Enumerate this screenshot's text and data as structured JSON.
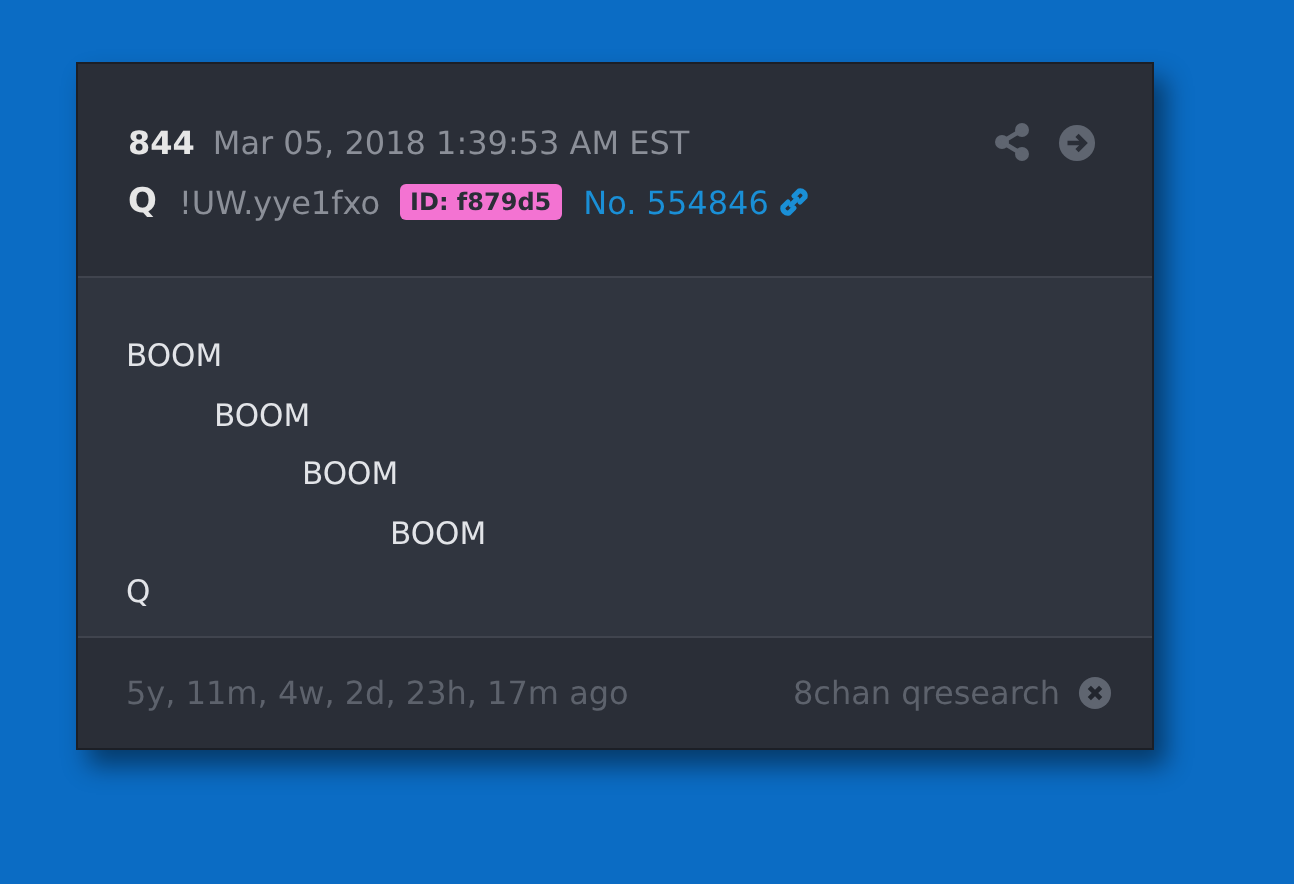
{
  "post": {
    "number": "844",
    "timestamp": "Mar 05, 2018 1:39:53 AM EST",
    "author": "Q",
    "tripcode": "!UW.yye1fxo",
    "id_badge": "ID: f879d5",
    "post_link": "No. 554846",
    "lines": [
      {
        "text": "BOOM",
        "children": [
          {
            "text": "BOOM",
            "children": [
              {
                "text": "BOOM",
                "children": [
                  {
                    "text": "BOOM"
                  }
                ]
              }
            ]
          }
        ]
      },
      {
        "text": "Q"
      }
    ],
    "age": "5y, 11m, 4w, 2d, 23h, 17m ago",
    "source": "8chan qresearch"
  }
}
